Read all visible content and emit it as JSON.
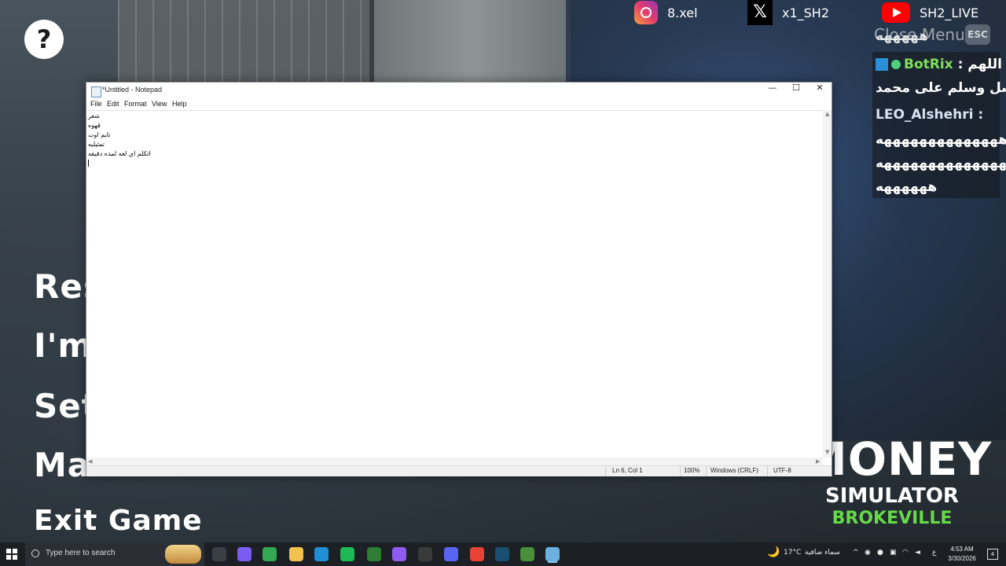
{
  "game": {
    "help_icon": "?",
    "menu": [
      "Res",
      "I'm",
      "Set",
      "Ma",
      "Exit Game"
    ],
    "social": {
      "instagram": "8.xel",
      "x": "x1_SH2",
      "youtube": "SH2_LIVE"
    },
    "close_menu": "Close Menu",
    "esc_key": "ESC",
    "chat": {
      "line1": "هههههه",
      "bot_name": "BotRix",
      "bot_msg": ": اللهم",
      "bot_msg2": "صل وسلم على محمد",
      "leo_name": "LEO_Alshehri :",
      "leo_msg1": "ههههههههههههههه",
      "leo_msg2": "هههههههههههههههه",
      "leo_msg3": "ههههههه"
    },
    "logo": {
      "line1": "MONEY",
      "line2": "SIMULATOR",
      "line3": "BROKEVILLE"
    }
  },
  "notepad": {
    "title": "*Untitled - Notepad",
    "controls": {
      "minimize": "—",
      "maximize": "☐",
      "close": "✕"
    },
    "menu": [
      "File",
      "Edit",
      "Format",
      "View",
      "Help"
    ],
    "lines": [
      "شعر",
      "قهوه",
      "تايم اوت",
      "تمثيليه",
      "اتكلم اي لغه لمده دقيقه"
    ],
    "status": {
      "position": "Ln 6, Col 1",
      "zoom": "100%",
      "line_ending": "Windows (CRLF)",
      "encoding": "UTF-8"
    }
  },
  "taskbar": {
    "search_placeholder": "Type here to search",
    "weather_temp": "17°C",
    "weather_text": "سماء صافية",
    "lang": "ع",
    "time": "4:53 AM",
    "date": "3/30/2026",
    "notif_count": "4",
    "apps": [
      {
        "name": "task-view-icon",
        "color": "#3a3f46"
      },
      {
        "name": "copilot-icon",
        "color": "#7b5cf0"
      },
      {
        "name": "play-store-icon",
        "color": "#34a853"
      },
      {
        "name": "file-explorer-icon",
        "color": "#f2c14e"
      },
      {
        "name": "edge-icon",
        "color": "#1f8fd6"
      },
      {
        "name": "spotify-icon",
        "color": "#1db954"
      },
      {
        "name": "xbox-icon",
        "color": "#2e7d32"
      },
      {
        "name": "messenger-icon",
        "color": "#8e5cf0"
      },
      {
        "name": "obs-icon",
        "color": "#3a3a3a"
      },
      {
        "name": "discord-icon",
        "color": "#5865f2"
      },
      {
        "name": "chrome-icon",
        "color": "#e84335"
      },
      {
        "name": "steam-icon",
        "color": "#1b4f72"
      },
      {
        "name": "money-sim-icon",
        "color": "#4a8f3a"
      },
      {
        "name": "notepad-icon",
        "color": "#6cb0e0"
      }
    ]
  }
}
